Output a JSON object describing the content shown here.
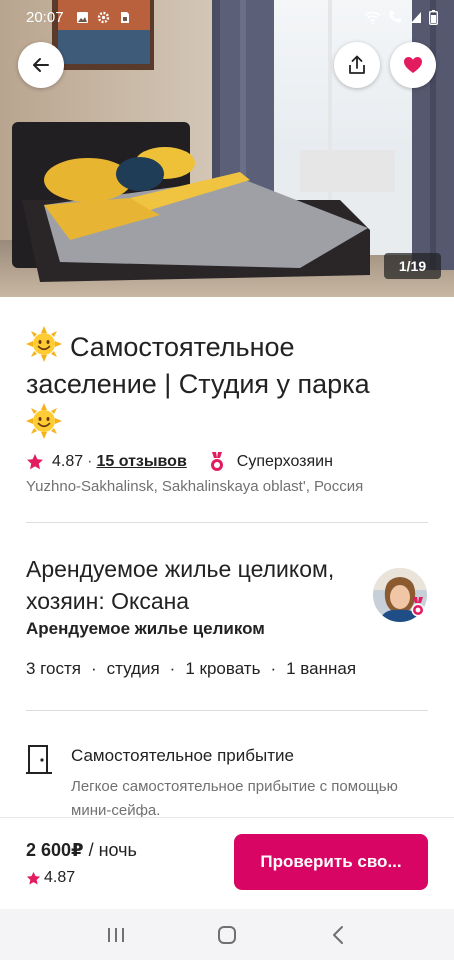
{
  "status_bar": {
    "time": "20:07",
    "icons": [
      "gallery-icon",
      "settings-icon",
      "sim-icon",
      "wifi-icon",
      "wifi-call-icon",
      "signal-icon",
      "battery-icon"
    ]
  },
  "gallery": {
    "counter": "1/19"
  },
  "listing": {
    "title": "Самостоятельное заселение | Студия у парка",
    "title_icons": [
      "sun-emoji-icon",
      "sun-emoji-icon"
    ],
    "rating": "4.87",
    "rating_sep": "·",
    "reviews": "15 отзывов",
    "superhost": "Суперхозяин",
    "location": "Yuzhno-Sakhalinsk, Sakhalinskaya oblast', Россия"
  },
  "host": {
    "title": "Арендуемое жилье целиком, хозяин: Оксана",
    "subtitle": "Арендуемое жилье целиком",
    "details": [
      "3 гостя",
      "студия",
      "1 кровать",
      "1 ванная"
    ],
    "details_sep": "·"
  },
  "feature": {
    "title": "Самостоятельное прибытие",
    "description": "Легкое самостоятельное прибытие с помощью мини-сейфа."
  },
  "footer": {
    "price": "2 600₽",
    "per": " / ночь",
    "rating": "4.87",
    "cta": "Проверить сво..."
  },
  "colors": {
    "brand": "#d80565",
    "star": "#e31c5f",
    "heart": "#e31c5f",
    "muted": "#717171"
  }
}
